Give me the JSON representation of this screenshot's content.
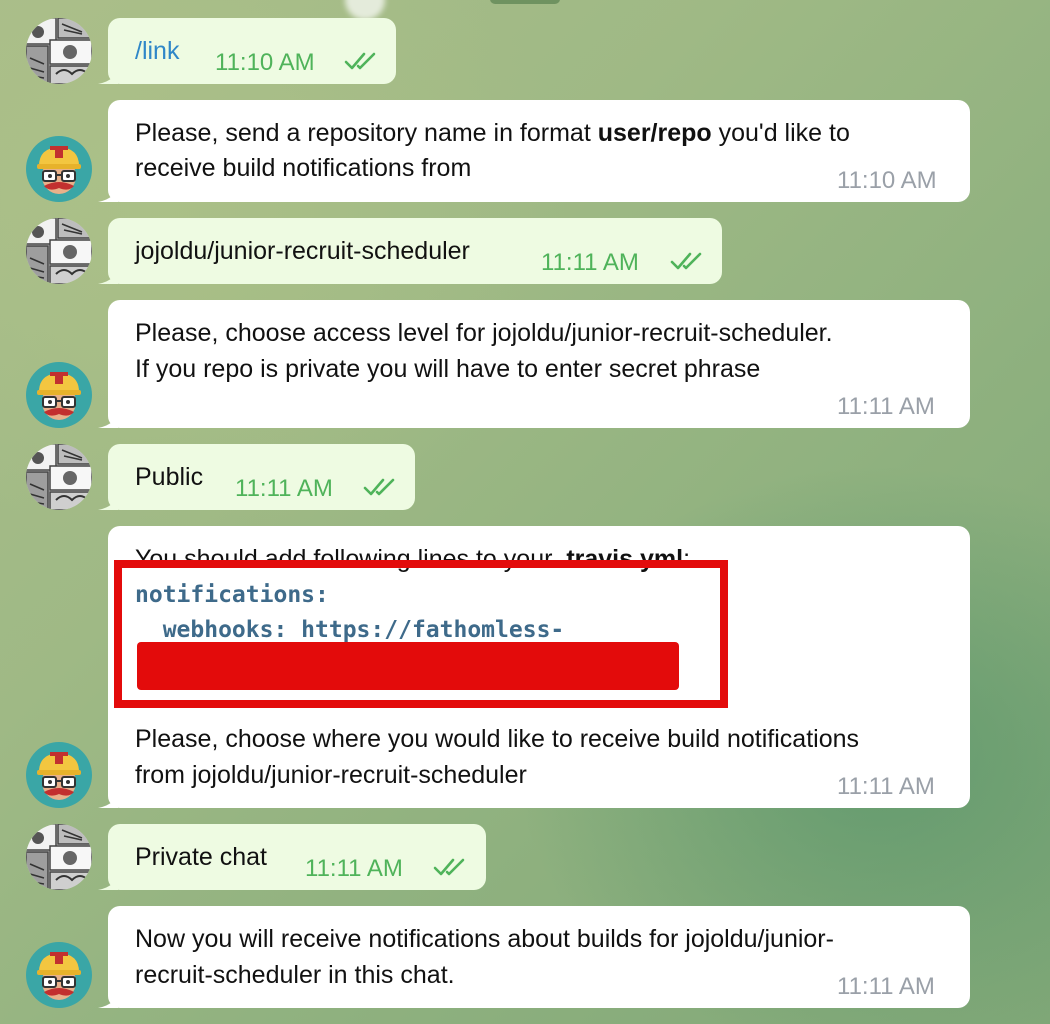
{
  "chat": {
    "messages": [
      {
        "from": "user",
        "text": "/link",
        "time": "11:10 AM",
        "status": "read-double-check"
      },
      {
        "from": "bot",
        "text_before": "Please, send a repository name in format ",
        "text_bold": "user/repo",
        "text_after": " you'd like to",
        "text_line2": "receive build notifications from",
        "time": "11:10 AM"
      },
      {
        "from": "user",
        "text": "jojoldu/junior-recruit-scheduler",
        "time": "11:11 AM",
        "status": "read-double-check"
      },
      {
        "from": "bot",
        "line1": "Please, choose access level for jojoldu/junior-recruit-scheduler.",
        "line2": "If you repo is private you will have to enter secret phrase",
        "time": "11:11 AM"
      },
      {
        "from": "user",
        "text": "Public",
        "time": "11:11 AM",
        "status": "read-double-check"
      },
      {
        "from": "bot",
        "intro_before": "You should add following lines to your ",
        "intro_bold": ".travis.yml",
        "intro_after": ":",
        "code_line1": "notifications:",
        "code_line2": "  webhooks: https://fathomless-",
        "redacted": true,
        "line1": "Please, choose where you would like to receive build notifications",
        "line2": "from jojoldu/junior-recruit-scheduler",
        "time": "11:11 AM"
      },
      {
        "from": "user",
        "text": "Private chat",
        "time": "11:11 AM",
        "status": "read-double-check"
      },
      {
        "from": "bot",
        "line1": "Now you will receive notifications about builds for jojoldu/junior-",
        "line2": "recruit-scheduler in this chat.",
        "time": "11:11 AM"
      }
    ]
  },
  "colors": {
    "outgoing_bubble": "#eefbe2",
    "incoming_bubble": "#ffffff",
    "time_out": "#4fb35a",
    "time_in": "#9aa0a8",
    "link": "#2f87c8",
    "highlight": "#e30b0b"
  },
  "icons": {
    "user_avatar": "manga-avatar-icon",
    "bot_avatar": "travis-ci-mascot-icon",
    "read_status": "double-check-icon"
  }
}
